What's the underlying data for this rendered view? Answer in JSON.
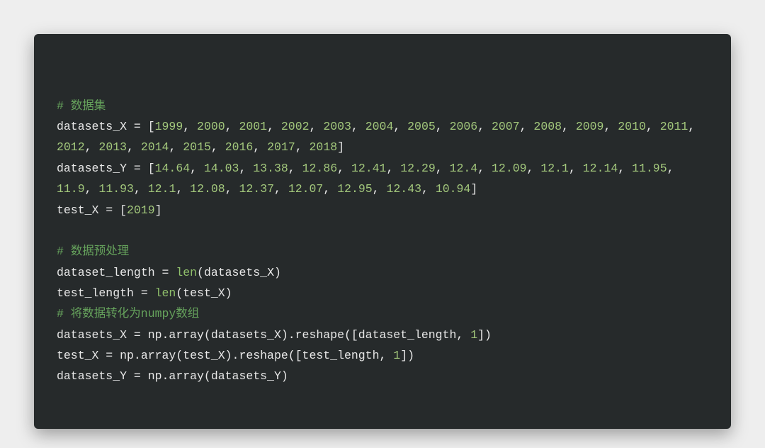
{
  "code": {
    "lines": [
      {
        "tokens": [
          {
            "t": "# 数据集",
            "cls": "c"
          }
        ]
      },
      {
        "tokens": [
          {
            "t": "datasets_X = [",
            "cls": "p"
          },
          {
            "t": "1999",
            "cls": "n"
          },
          {
            "t": ", ",
            "cls": "p"
          },
          {
            "t": "2000",
            "cls": "n"
          },
          {
            "t": ", ",
            "cls": "p"
          },
          {
            "t": "2001",
            "cls": "n"
          },
          {
            "t": ", ",
            "cls": "p"
          },
          {
            "t": "2002",
            "cls": "n"
          },
          {
            "t": ", ",
            "cls": "p"
          },
          {
            "t": "2003",
            "cls": "n"
          },
          {
            "t": ", ",
            "cls": "p"
          },
          {
            "t": "2004",
            "cls": "n"
          },
          {
            "t": ", ",
            "cls": "p"
          },
          {
            "t": "2005",
            "cls": "n"
          },
          {
            "t": ", ",
            "cls": "p"
          },
          {
            "t": "2006",
            "cls": "n"
          },
          {
            "t": ", ",
            "cls": "p"
          },
          {
            "t": "2007",
            "cls": "n"
          },
          {
            "t": ", ",
            "cls": "p"
          },
          {
            "t": "2008",
            "cls": "n"
          },
          {
            "t": ", ",
            "cls": "p"
          },
          {
            "t": "2009",
            "cls": "n"
          },
          {
            "t": ", ",
            "cls": "p"
          },
          {
            "t": "2010",
            "cls": "n"
          },
          {
            "t": ", ",
            "cls": "p"
          },
          {
            "t": "2011",
            "cls": "n"
          },
          {
            "t": ", ",
            "cls": "p"
          },
          {
            "t": "2012",
            "cls": "n"
          },
          {
            "t": ", ",
            "cls": "p"
          },
          {
            "t": "2013",
            "cls": "n"
          },
          {
            "t": ", ",
            "cls": "p"
          },
          {
            "t": "2014",
            "cls": "n"
          },
          {
            "t": ", ",
            "cls": "p"
          },
          {
            "t": "2015",
            "cls": "n"
          },
          {
            "t": ", ",
            "cls": "p"
          },
          {
            "t": "2016",
            "cls": "n"
          },
          {
            "t": ", ",
            "cls": "p"
          },
          {
            "t": "2017",
            "cls": "n"
          },
          {
            "t": ", ",
            "cls": "p"
          },
          {
            "t": "2018",
            "cls": "n"
          },
          {
            "t": "]",
            "cls": "p"
          }
        ]
      },
      {
        "tokens": [
          {
            "t": "datasets_Y = [",
            "cls": "p"
          },
          {
            "t": "14.64",
            "cls": "n"
          },
          {
            "t": ", ",
            "cls": "p"
          },
          {
            "t": "14.03",
            "cls": "n"
          },
          {
            "t": ", ",
            "cls": "p"
          },
          {
            "t": "13.38",
            "cls": "n"
          },
          {
            "t": ", ",
            "cls": "p"
          },
          {
            "t": "12.86",
            "cls": "n"
          },
          {
            "t": ", ",
            "cls": "p"
          },
          {
            "t": "12.41",
            "cls": "n"
          },
          {
            "t": ", ",
            "cls": "p"
          },
          {
            "t": "12.29",
            "cls": "n"
          },
          {
            "t": ", ",
            "cls": "p"
          },
          {
            "t": "12.4",
            "cls": "n"
          },
          {
            "t": ", ",
            "cls": "p"
          },
          {
            "t": "12.09",
            "cls": "n"
          },
          {
            "t": ", ",
            "cls": "p"
          },
          {
            "t": "12.1",
            "cls": "n"
          },
          {
            "t": ", ",
            "cls": "p"
          },
          {
            "t": "12.14",
            "cls": "n"
          },
          {
            "t": ", ",
            "cls": "p"
          },
          {
            "t": "11.95",
            "cls": "n"
          },
          {
            "t": ", ",
            "cls": "p"
          },
          {
            "t": "11.9",
            "cls": "n"
          },
          {
            "t": ", ",
            "cls": "p"
          },
          {
            "t": "11.93",
            "cls": "n"
          },
          {
            "t": ", ",
            "cls": "p"
          },
          {
            "t": "12.1",
            "cls": "n"
          },
          {
            "t": ", ",
            "cls": "p"
          },
          {
            "t": "12.08",
            "cls": "n"
          },
          {
            "t": ", ",
            "cls": "p"
          },
          {
            "t": "12.37",
            "cls": "n"
          },
          {
            "t": ", ",
            "cls": "p"
          },
          {
            "t": "12.07",
            "cls": "n"
          },
          {
            "t": ", ",
            "cls": "p"
          },
          {
            "t": "12.95",
            "cls": "n"
          },
          {
            "t": ", ",
            "cls": "p"
          },
          {
            "t": "12.43",
            "cls": "n"
          },
          {
            "t": ", ",
            "cls": "p"
          },
          {
            "t": "10.94",
            "cls": "n"
          },
          {
            "t": "]",
            "cls": "p"
          }
        ]
      },
      {
        "tokens": [
          {
            "t": "test_X = [",
            "cls": "p"
          },
          {
            "t": "2019",
            "cls": "n"
          },
          {
            "t": "]",
            "cls": "p"
          }
        ]
      },
      {
        "tokens": [
          {
            "t": "",
            "cls": "p"
          }
        ]
      },
      {
        "tokens": [
          {
            "t": "# 数据预处理",
            "cls": "c"
          }
        ]
      },
      {
        "tokens": [
          {
            "t": "dataset_length = ",
            "cls": "p"
          },
          {
            "t": "len",
            "cls": "k"
          },
          {
            "t": "(datasets_X)",
            "cls": "p"
          }
        ]
      },
      {
        "tokens": [
          {
            "t": "test_length = ",
            "cls": "p"
          },
          {
            "t": "len",
            "cls": "k"
          },
          {
            "t": "(test_X)",
            "cls": "p"
          }
        ]
      },
      {
        "tokens": [
          {
            "t": "# 将数据转化为numpy数组",
            "cls": "c"
          }
        ]
      },
      {
        "tokens": [
          {
            "t": "datasets_X = np.array(datasets_X).reshape([dataset_length, ",
            "cls": "p"
          },
          {
            "t": "1",
            "cls": "n"
          },
          {
            "t": "])",
            "cls": "p"
          }
        ]
      },
      {
        "tokens": [
          {
            "t": "test_X = np.array(test_X).reshape([test_length, ",
            "cls": "p"
          },
          {
            "t": "1",
            "cls": "n"
          },
          {
            "t": "])",
            "cls": "p"
          }
        ]
      },
      {
        "tokens": [
          {
            "t": "datasets_Y = np.array(datasets_Y)",
            "cls": "p"
          }
        ]
      }
    ]
  }
}
